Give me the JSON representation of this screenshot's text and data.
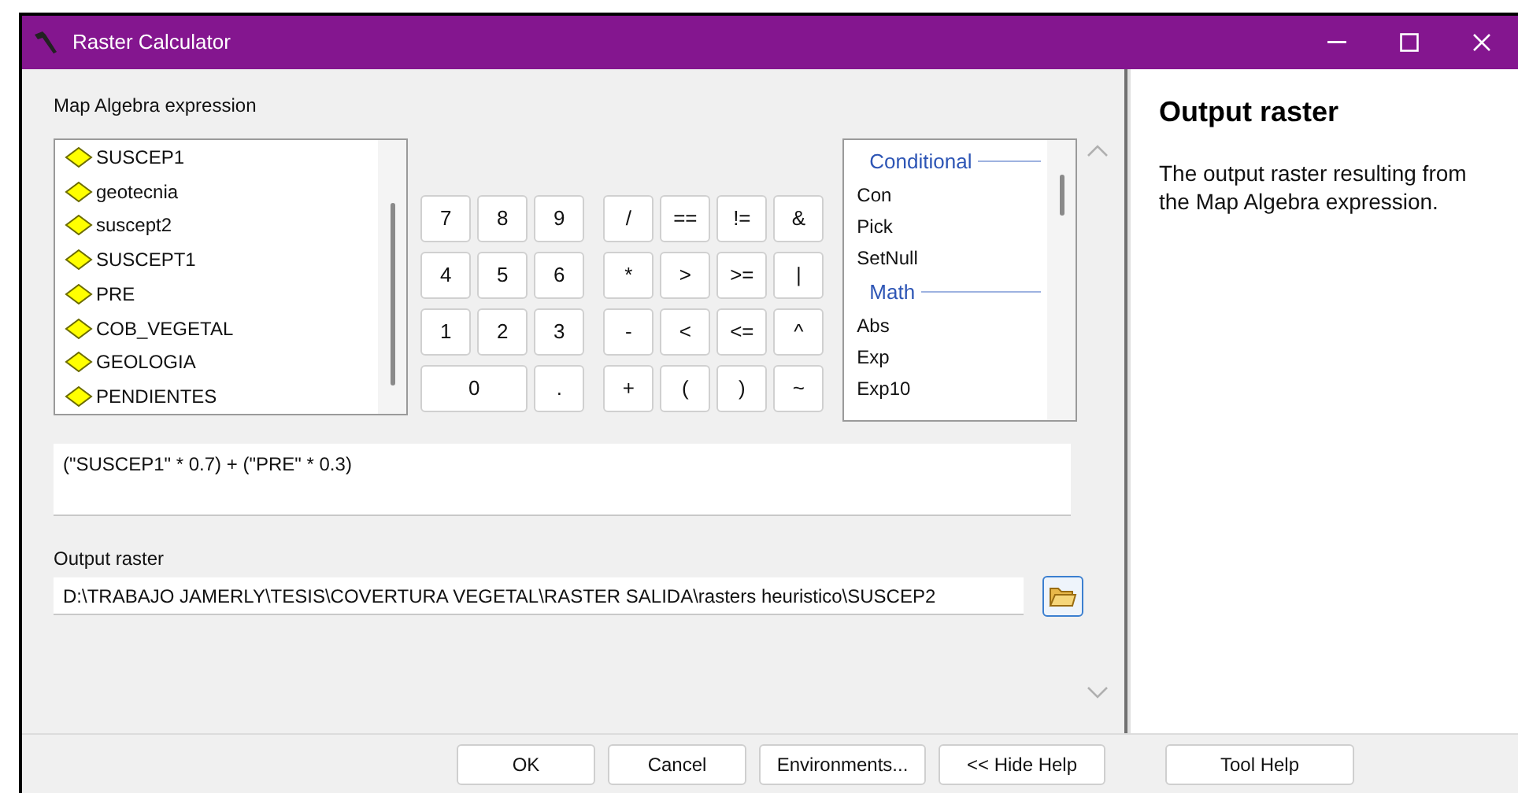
{
  "window": {
    "title": "Raster Calculator"
  },
  "expression_label": "Map Algebra expression",
  "layers": [
    "SUSCEP1",
    "geotecnia",
    "suscept2",
    "SUSCEPT1",
    "PRE",
    "COB_VEGETAL",
    "GEOLOGIA",
    "PENDIENTES"
  ],
  "keypad": [
    [
      "7",
      "8",
      "9",
      "/",
      "==",
      "!=",
      "&"
    ],
    [
      "4",
      "5",
      "6",
      "*",
      ">",
      ">=",
      "|"
    ],
    [
      "1",
      "2",
      "3",
      "-",
      "<",
      "<=",
      "^"
    ],
    [
      "0",
      ".",
      "+",
      "(",
      ")",
      "~"
    ]
  ],
  "functions": [
    {
      "kind": "group",
      "label": "Conditional"
    },
    {
      "kind": "item",
      "label": "Con"
    },
    {
      "kind": "item",
      "label": "Pick"
    },
    {
      "kind": "item",
      "label": "SetNull"
    },
    {
      "kind": "group",
      "label": "Math"
    },
    {
      "kind": "item",
      "label": "Abs"
    },
    {
      "kind": "item",
      "label": "Exp"
    },
    {
      "kind": "item",
      "label": "Exp10"
    }
  ],
  "expression": "(\"SUSCEP1\" * 0.7) + (\"PRE\" * 0.3)",
  "output_label": "Output raster",
  "output_value": "D:\\TRABAJO JAMERLY\\TESIS\\COVERTURA VEGETAL\\RASTER SALIDA\\rasters heuristico\\SUSCEP2",
  "help": {
    "title": "Output raster",
    "text": "The output raster resulting from the Map Algebra expression."
  },
  "buttons": [
    "OK",
    "Cancel",
    "Environments...",
    "<< Hide Help",
    "Tool Help"
  ]
}
